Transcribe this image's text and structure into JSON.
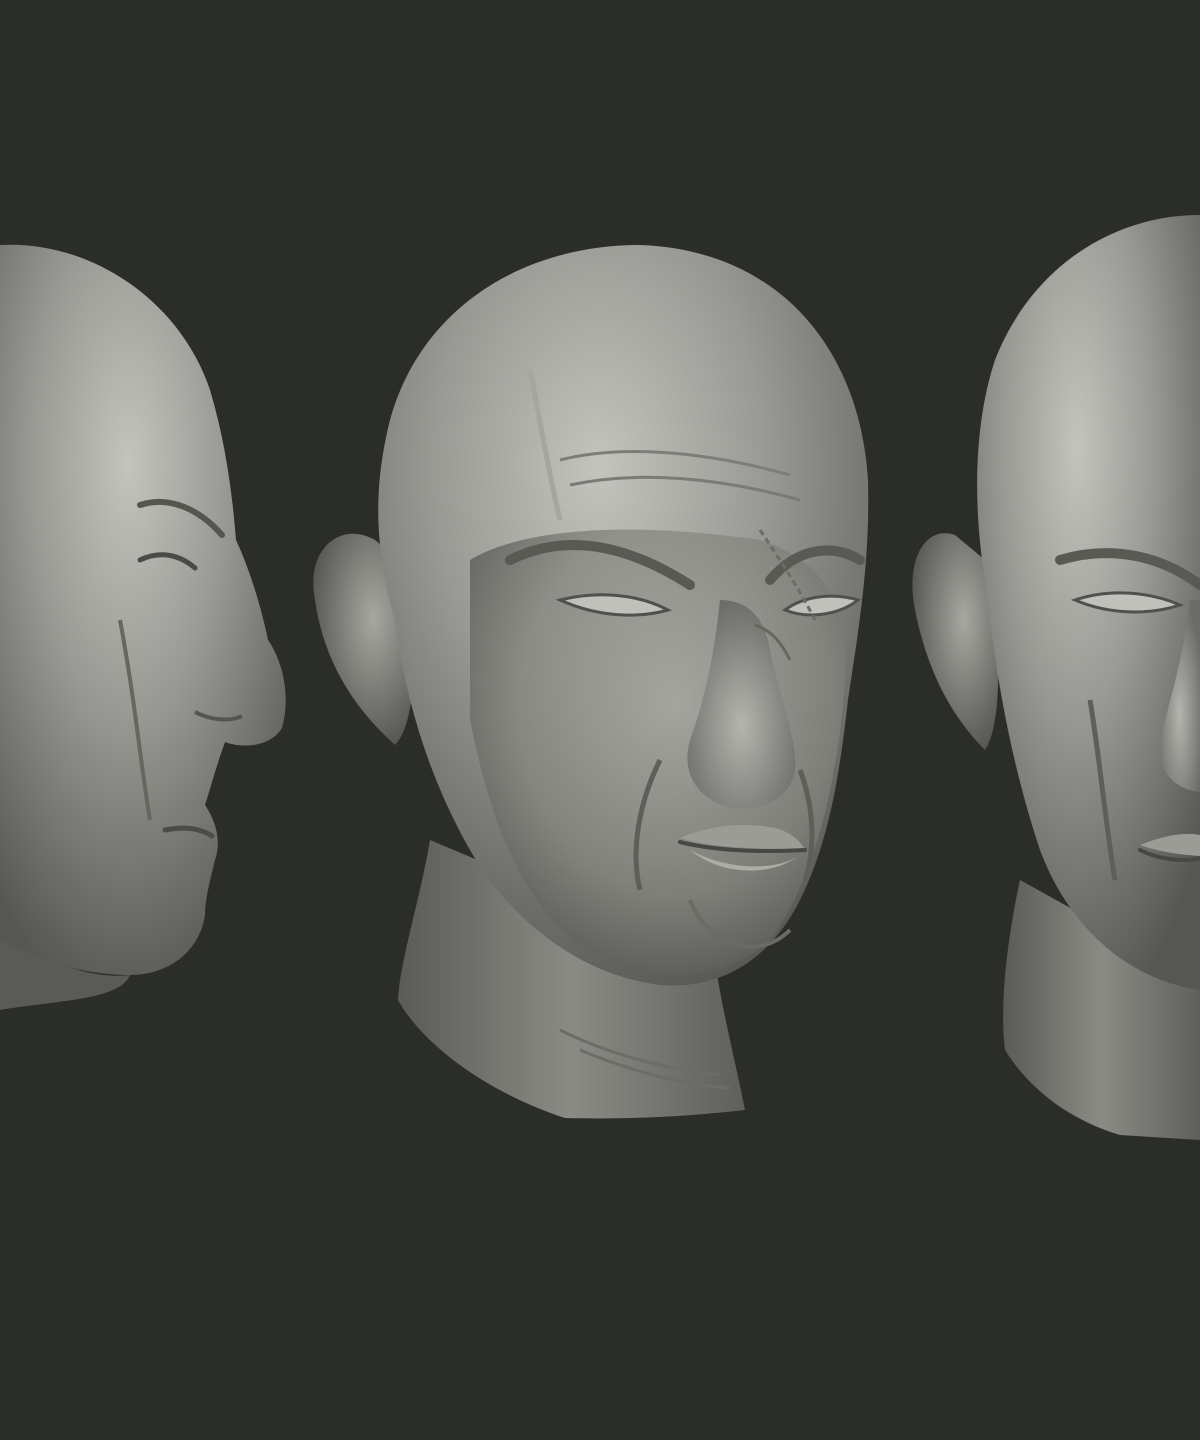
{
  "scene": {
    "background_color": "#2b2d28",
    "clay_color": "#8f8f8a",
    "clay_highlight": "#c9c9c3",
    "clay_shadow": "#4a4b47",
    "views": [
      {
        "name": "left-profile-view",
        "icon": "sculpted-head-profile"
      },
      {
        "name": "front-view",
        "icon": "sculpted-head-front"
      },
      {
        "name": "three-quarter-view",
        "icon": "sculpted-head-three-quarter"
      }
    ]
  }
}
